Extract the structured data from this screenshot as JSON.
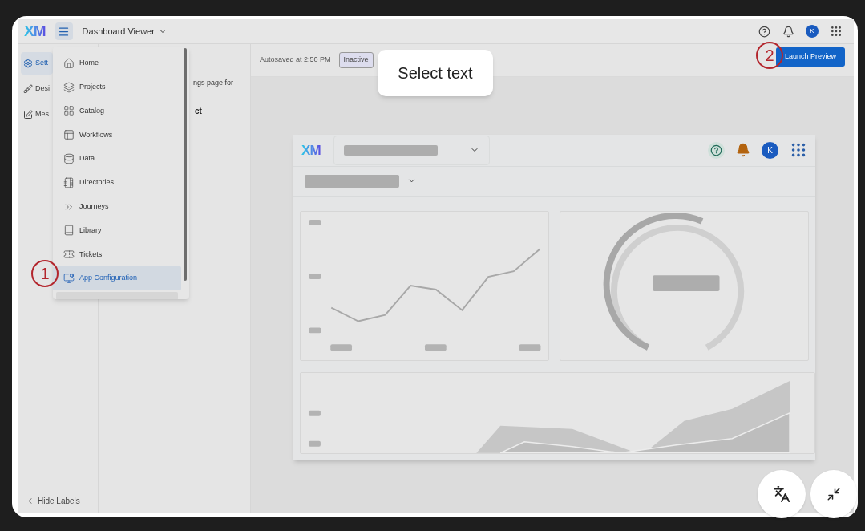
{
  "top_bar": {
    "logo": "XM",
    "app_switcher": "Dashboard Viewer",
    "avatar": "K"
  },
  "rail": {
    "items": [
      {
        "label": "Sett",
        "selected": true
      },
      {
        "label": "Desi",
        "selected": false
      },
      {
        "label": "Mes",
        "selected": false
      }
    ],
    "hide_labels": "Hide Labels"
  },
  "settings_panel": {
    "text_1": "ngs page for",
    "text_2": "ct"
  },
  "menu": {
    "items": [
      {
        "label": "Home",
        "selected": false
      },
      {
        "label": "Projects",
        "selected": false
      },
      {
        "label": "Catalog",
        "selected": false
      },
      {
        "label": "Workflows",
        "selected": false
      },
      {
        "label": "Data",
        "selected": false
      },
      {
        "label": "Directories",
        "selected": false
      },
      {
        "label": "Journeys",
        "selected": false
      },
      {
        "label": "Library",
        "selected": false
      },
      {
        "label": "Tickets",
        "selected": false
      },
      {
        "label": "App Configuration",
        "selected": true
      }
    ]
  },
  "toolbar": {
    "autosave": "Autosaved at 2:50 PM",
    "status": "Inactive",
    "tooltip": "Select text",
    "launch_button": "Launch Preview"
  },
  "preview": {
    "logo": "XM",
    "avatar": "K"
  },
  "annotations": [
    "1",
    "2"
  ]
}
